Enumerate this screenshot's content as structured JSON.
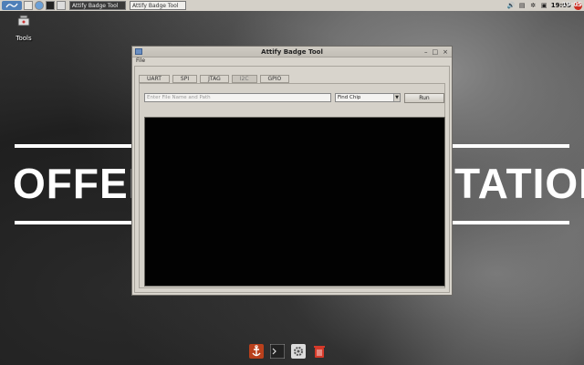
{
  "desktop": {
    "wallpaper_text_left": "OFFEN",
    "wallpaper_text_right": "TATION",
    "tools_label": "Tools"
  },
  "taskbar": {
    "tasks": [
      "Attify Badge Tool",
      "Attify Badge Tool"
    ],
    "clock": "19:05",
    "right_clock": "19:05"
  },
  "window": {
    "title": "Attify Badge Tool",
    "controls": {
      "minimize": "–",
      "maximize": "□",
      "close": "×"
    },
    "menu": {
      "file": "File"
    },
    "tabs": [
      {
        "label": "UART"
      },
      {
        "label": "SPI"
      },
      {
        "label": "JTAG"
      },
      {
        "label": "I2C"
      },
      {
        "label": "GPIO"
      }
    ],
    "selected_tab": "I2C",
    "file_input": {
      "placeholder": "Enter File Name and Path",
      "value": ""
    },
    "chip_select": {
      "value": "Find Chip"
    },
    "run_button": "Run"
  },
  "dock": {
    "items": [
      "anchor-icon",
      "terminal-icon",
      "settings-icon",
      "trash-icon"
    ]
  },
  "colors": {
    "console_bg": "#020202",
    "window_bg": "#d8d4cc",
    "power_red": "#cc2b1f",
    "menu_blue": "#4f7fb8"
  }
}
